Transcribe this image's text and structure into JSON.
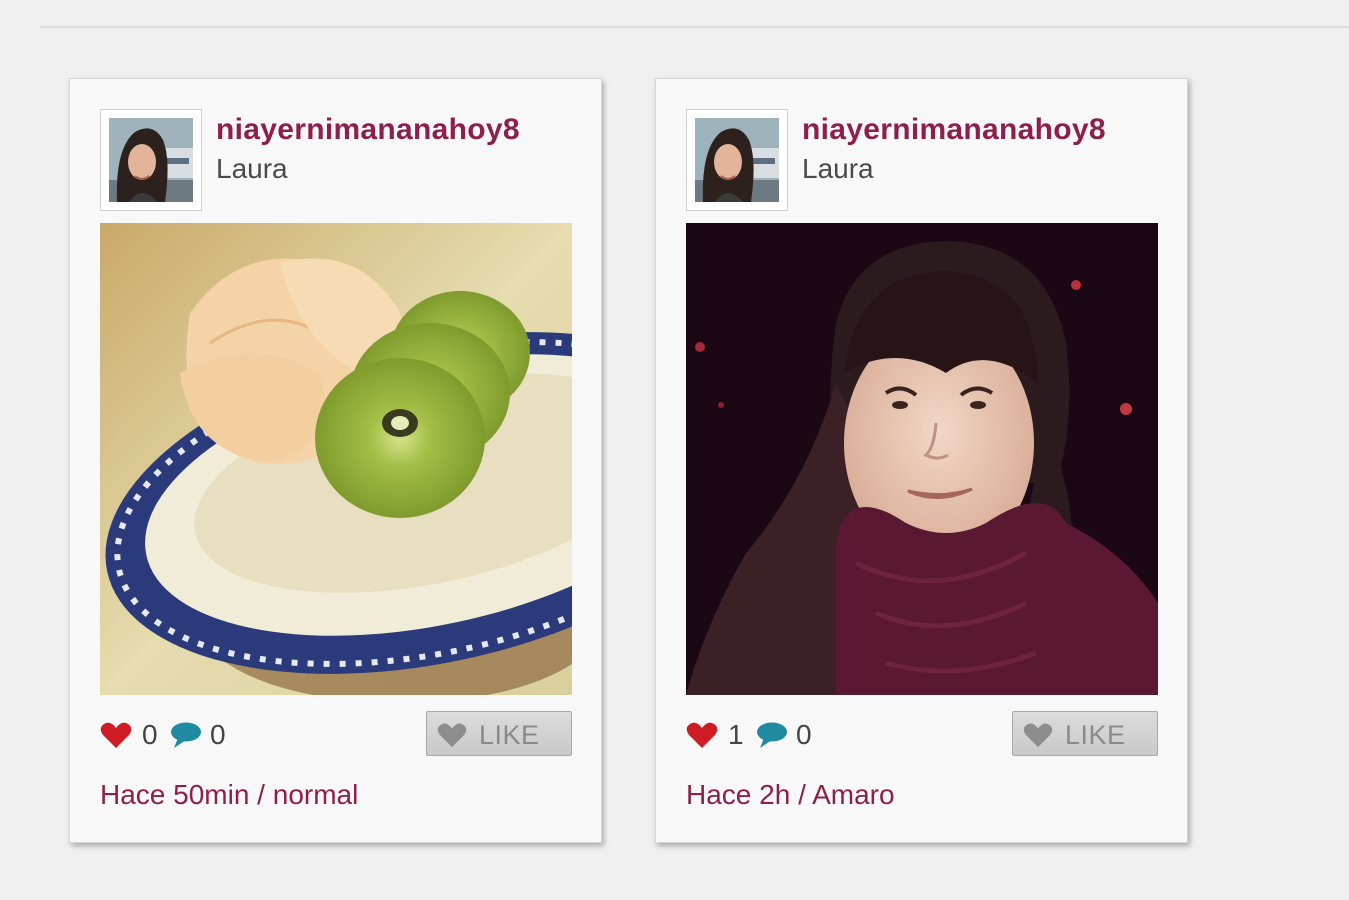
{
  "colors": {
    "brand": "#8e1f4c",
    "heart": "#cf1b23",
    "comment": "#1f8aa0",
    "button_bg": "#d3d3d3",
    "page_bg": "#efefef"
  },
  "posts": [
    {
      "username": "niayernimananahoy8",
      "real_name": "Laura",
      "likes": "0",
      "comments": "0",
      "like_label": "LIKE",
      "meta": "Hace 50min / normal",
      "photo_subject": "plate of tangerine segments and kiwi slices"
    },
    {
      "username": "niayernimananahoy8",
      "real_name": "Laura",
      "likes": "1",
      "comments": "0",
      "like_label": "LIKE",
      "meta": "Hace 2h / Amaro",
      "photo_subject": "portrait of a woman with bangs and a maroon scarf"
    }
  ],
  "icons": {
    "heart": "heart-icon",
    "comment": "speech-bubble-icon",
    "like_button": "heart-outline-icon"
  }
}
